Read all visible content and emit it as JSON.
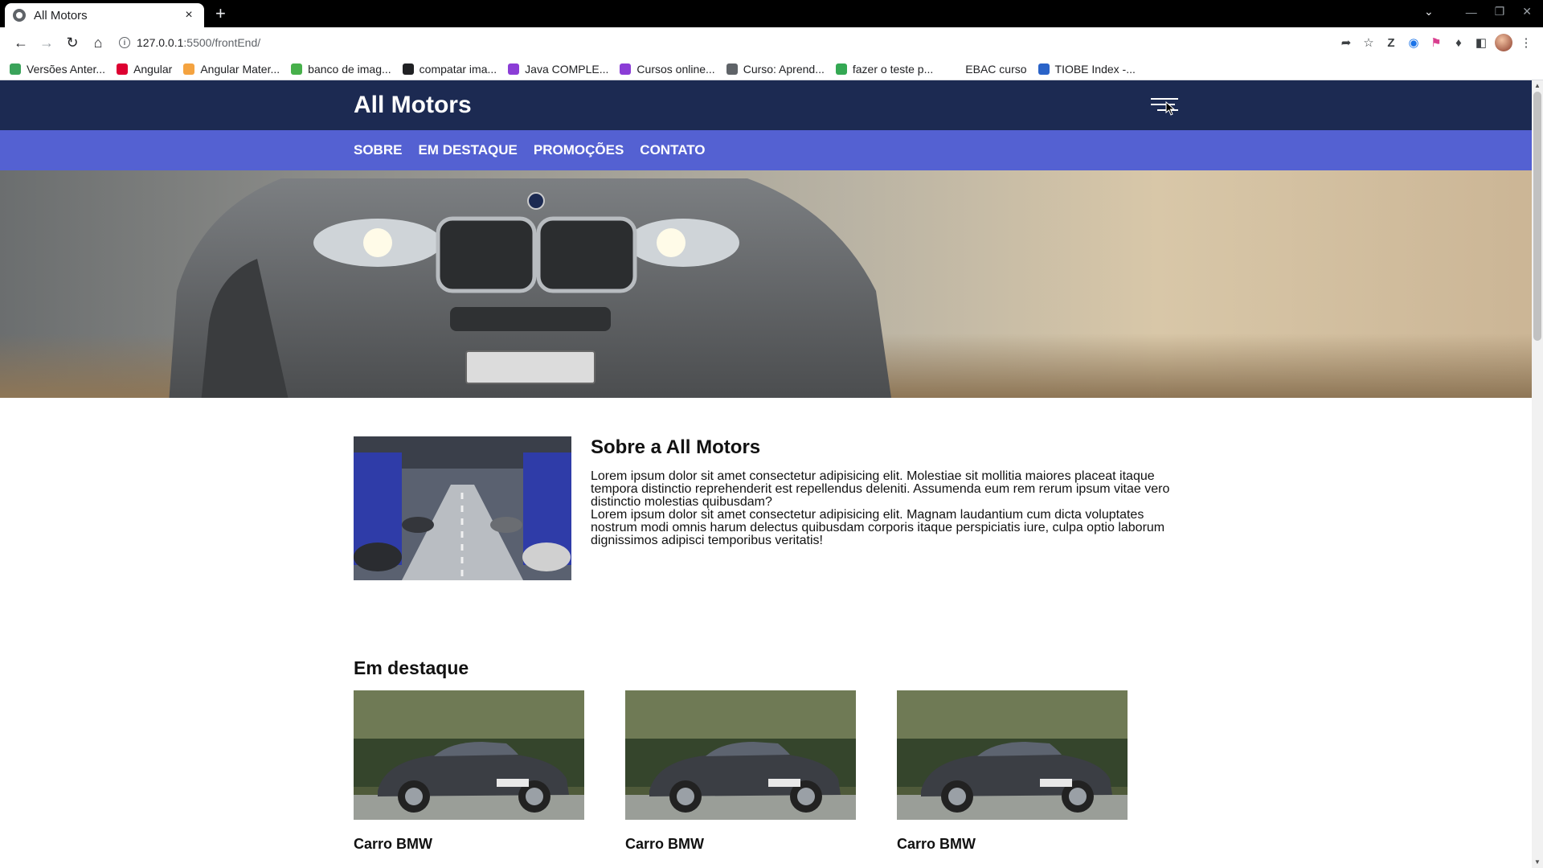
{
  "browser": {
    "tab_title": "All Motors",
    "tab_close": "×",
    "new_tab": "+",
    "url_host": "127.0.0.1",
    "url_path": ":5500/frontEnd/",
    "bookmarks": [
      {
        "label": "Versões Anter...",
        "color": "#3aa35a"
      },
      {
        "label": "Angular",
        "color": "#dd0031"
      },
      {
        "label": "Angular Mater...",
        "color": "#f4a340"
      },
      {
        "label": "banco de imag...",
        "color": "#47b04b"
      },
      {
        "label": "compatar ima...",
        "color": "#202124"
      },
      {
        "label": "Java COMPLE...",
        "color": "#8b3dd6"
      },
      {
        "label": "Cursos online...",
        "color": "#8b3dd6"
      },
      {
        "label": "Curso: Aprend...",
        "color": "#5f6368"
      },
      {
        "label": "fazer o teste p...",
        "color": "#34a853"
      },
      {
        "label": "EBAC curso",
        "color": ""
      },
      {
        "label": "TIOBE Index -...",
        "color": "#2a63c8"
      }
    ]
  },
  "site": {
    "brand": "All Motors",
    "nav": [
      "SOBRE",
      "EM DESTAQUE",
      "PROMOÇÕES",
      "CONTATO"
    ],
    "about": {
      "title": "Sobre a All Motors",
      "p1": "Lorem ipsum dolor sit amet consectetur adipisicing elit. Molestiae sit mollitia maiores placeat itaque tempora distinctio reprehenderit est repellendus deleniti. Assumenda eum rem rerum ipsum vitae vero distinctio molestias quibusdam?",
      "p2": "Lorem ipsum dolor sit amet consectetur adipisicing elit. Magnam laudantium cum dicta voluptates nostrum modi omnis harum delectus quibusdam corporis itaque perspiciatis iure, culpa optio laborum dignissimos adipisci temporibus veritatis!"
    },
    "featured": {
      "title": "Em destaque",
      "cards": [
        {
          "title": "Carro BMW"
        },
        {
          "title": "Carro BMW"
        },
        {
          "title": "Carro BMW"
        }
      ]
    }
  },
  "colors": {
    "header": "#1c2a52",
    "nav": "#5461d2"
  }
}
